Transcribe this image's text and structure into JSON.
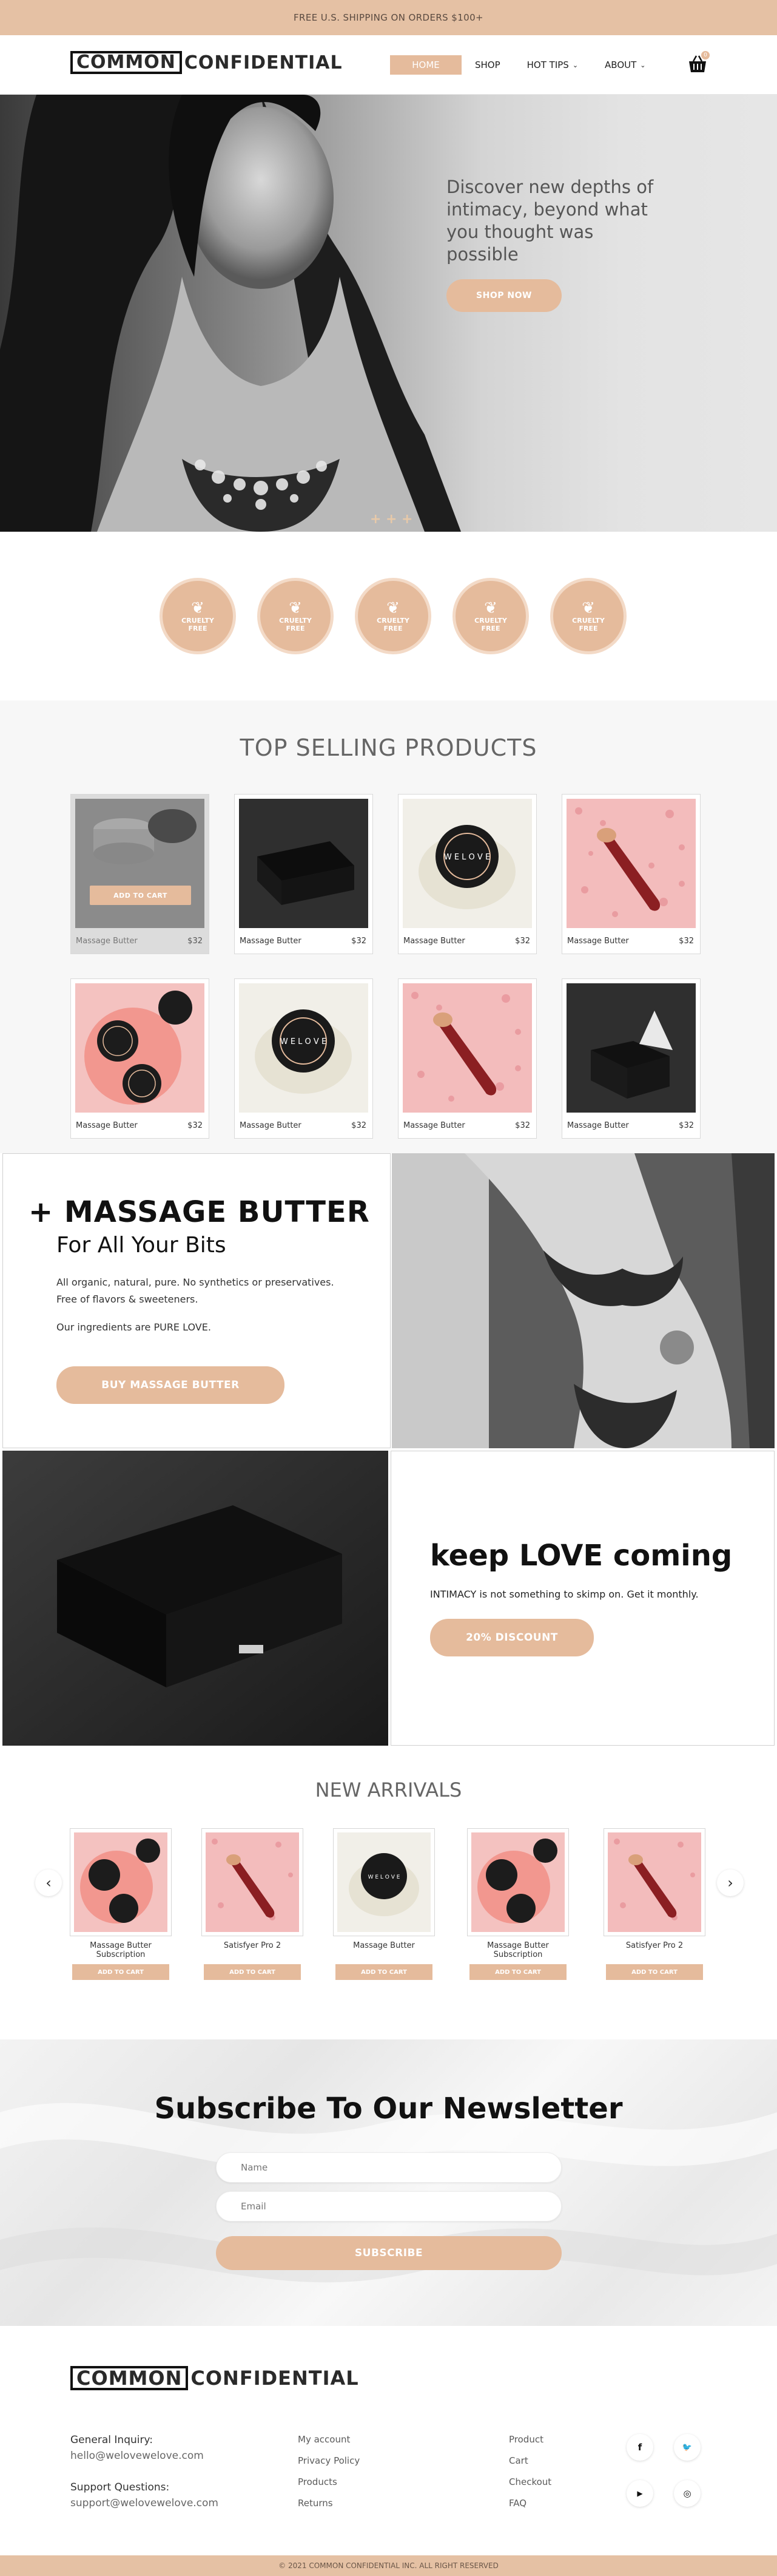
{
  "topbar": {
    "text": "FREE U.S. SHIPPING ON ORDERS $100+"
  },
  "header": {
    "logo_left": "COMMON",
    "logo_right": "CONFIDENTIAL",
    "nav": [
      {
        "label": "HOME"
      },
      {
        "label": "SHOP"
      },
      {
        "label": "HOT TIPS"
      },
      {
        "label": "ABOUT"
      }
    ],
    "cart_icon": "basket-icon",
    "cart_count": "0"
  },
  "hero": {
    "headline": "Discover new depths of intimacy, beyond what you thought was possible",
    "cta": "SHOP NOW"
  },
  "badges": [
    {
      "label": "CRUELTY FREE",
      "icon": "leaf-icon"
    },
    {
      "label": "CRUELTY FREE",
      "icon": "leaf-icon"
    },
    {
      "label": "CRUELTY FREE",
      "icon": "leaf-icon"
    },
    {
      "label": "CRUELTY FREE",
      "icon": "leaf-icon"
    },
    {
      "label": "CRUELTY FREE",
      "icon": "leaf-icon"
    }
  ],
  "top_selling": {
    "title": "TOP SELLING PRODUCTS",
    "add_to_cart": "ADD TO CART",
    "products": [
      {
        "name": "Massage Butter",
        "price": "$32",
        "image": "jar-open"
      },
      {
        "name": "Massage Butter",
        "price": "$32",
        "image": "black-box"
      },
      {
        "name": "Massage Butter",
        "price": "$32",
        "image": "jar-white"
      },
      {
        "name": "Massage Butter",
        "price": "$32",
        "image": "toy-pink"
      },
      {
        "name": "Massage Butter",
        "price": "$32",
        "image": "jars-pink"
      },
      {
        "name": "Massage Butter",
        "price": "$32",
        "image": "jar-white"
      },
      {
        "name": "Massage Butter",
        "price": "$32",
        "image": "toy-pink"
      },
      {
        "name": "Massage Butter",
        "price": "$32",
        "image": "black-box-open"
      }
    ]
  },
  "massage_butter": {
    "title": "+ MASSAGE BUTTER",
    "subtitle": "For All Your Bits",
    "line1": "All organic, natural, pure. No synthetics or preservatives.",
    "line2": "Free of flavors & sweeteners.",
    "line3": "Our ingredients are PURE LOVE.",
    "cta": "BUY MASSAGE BUTTER"
  },
  "subscription": {
    "title": "keep LOVE coming",
    "text": "INTIMACY  is not something to skimp on. Get it monthly.",
    "cta": "20% DISCOUNT"
  },
  "new_arrivals": {
    "title": "NEW ARRIVALS",
    "add_to_cart": "ADD TO CART",
    "prev": "‹",
    "next": "›",
    "items": [
      {
        "name": "Massage Butter Subscription",
        "image": "jars-pink"
      },
      {
        "name": "Satisfyer Pro 2",
        "image": "toy-pink"
      },
      {
        "name": "Massage Butter",
        "image": "jar-white"
      },
      {
        "name": "Massage Butter Subscription",
        "image": "jars-pink"
      },
      {
        "name": "Satisfyer Pro 2",
        "image": "toy-pink"
      }
    ]
  },
  "newsletter": {
    "title": "Subscribe To Our Newsletter",
    "name_placeholder": "Name",
    "email_placeholder": "Email",
    "cta": "SUBSCRIBE"
  },
  "footer": {
    "logo_left": "COMMON",
    "logo_right": "CONFIDENTIAL",
    "inquiry_label": "General Inquiry:",
    "inquiry_email": "hello@welovewelove.com",
    "support_label": "Support Questions:",
    "support_email": "support@welovewelove.com",
    "col2": [
      "My account",
      "Privacy Policy",
      "Products",
      "Returns"
    ],
    "col3": [
      "Product",
      "Cart",
      "Checkout",
      "FAQ"
    ],
    "social": [
      {
        "icon": "facebook-icon",
        "glyph": "f"
      },
      {
        "icon": "twitter-icon",
        "glyph": "🐦"
      },
      {
        "icon": "youtube-icon",
        "glyph": "▶"
      },
      {
        "icon": "instagram-icon",
        "glyph": "◎"
      }
    ],
    "copyright": "© 2021 COMMON CONFIDENTIAL INC. ALL RIGHT RESERVED"
  },
  "colors": {
    "accent": "#e5bb9c",
    "topbar": "#e5c1a4",
    "text": "#2a2a2a"
  }
}
